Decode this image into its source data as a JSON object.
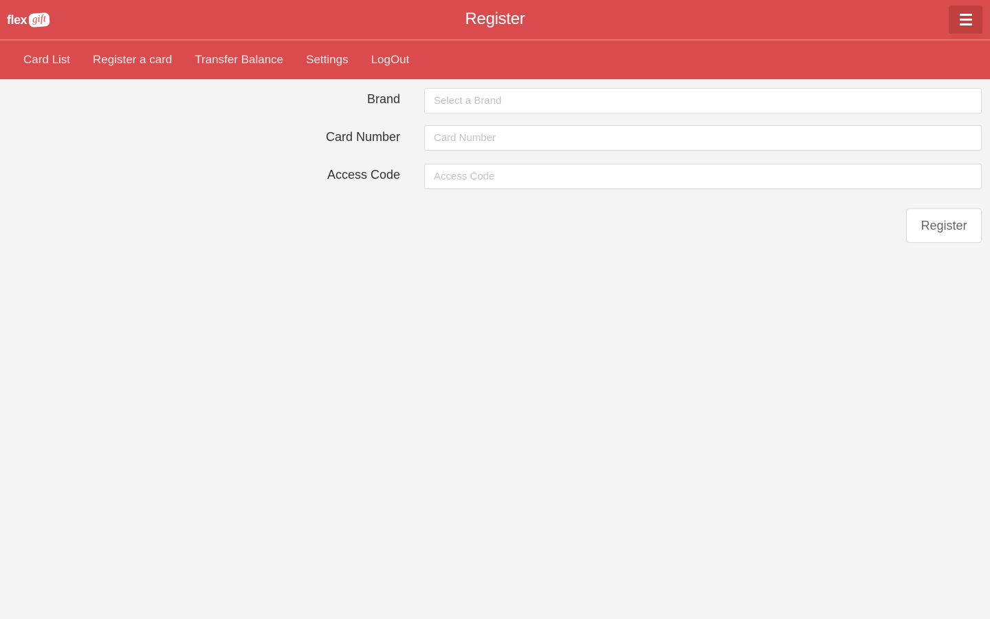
{
  "header": {
    "logo": {
      "word": "flex",
      "badge": "gift"
    },
    "title": "Register",
    "menu_icon": "hamburger-menu-icon"
  },
  "nav": {
    "items": [
      {
        "label": "Card List"
      },
      {
        "label": "Register a card"
      },
      {
        "label": "Transfer Balance"
      },
      {
        "label": "Settings"
      },
      {
        "label": "LogOut"
      }
    ]
  },
  "form": {
    "brand": {
      "label": "Brand",
      "placeholder": "Select a Brand",
      "value": ""
    },
    "card_number": {
      "label": "Card Number",
      "placeholder": "Card Number",
      "value": ""
    },
    "access_code": {
      "label": "Access Code",
      "placeholder": "Access Code",
      "value": ""
    },
    "submit_label": "Register"
  },
  "colors": {
    "header_bg": "#d94b4c",
    "page_bg": "#f4f4f4"
  }
}
